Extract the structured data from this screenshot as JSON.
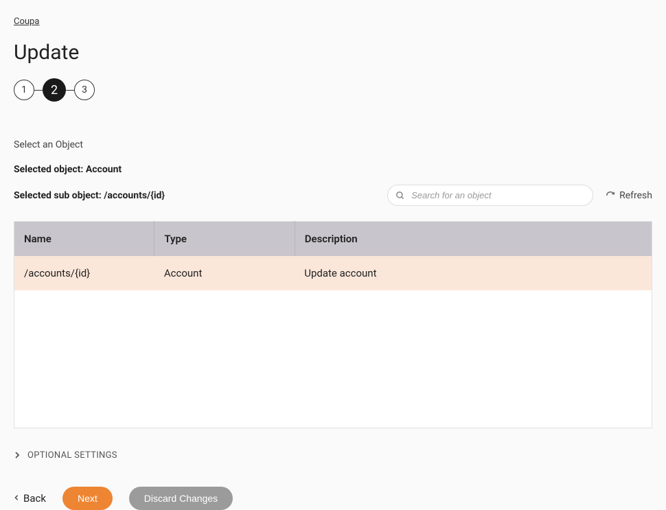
{
  "breadcrumb": {
    "label": "Coupa"
  },
  "page": {
    "title": "Update"
  },
  "stepper": {
    "steps": [
      {
        "label": "1",
        "active": false
      },
      {
        "label": "2",
        "active": true
      },
      {
        "label": "3",
        "active": false
      }
    ]
  },
  "section": {
    "select_label": "Select an Object",
    "selected_object_line": "Selected object: Account",
    "selected_sub_object_line": "Selected sub object: /accounts/{id}"
  },
  "search": {
    "placeholder": "Search for an object"
  },
  "refresh": {
    "label": "Refresh"
  },
  "table": {
    "headers": {
      "name": "Name",
      "type": "Type",
      "description": "Description"
    },
    "rows": [
      {
        "name": "/accounts/{id}",
        "type": "Account",
        "description": "Update account",
        "selected": true
      }
    ]
  },
  "optional_settings": {
    "label": "OPTIONAL SETTINGS"
  },
  "footer": {
    "back": "Back",
    "next": "Next",
    "discard": "Discard Changes"
  }
}
